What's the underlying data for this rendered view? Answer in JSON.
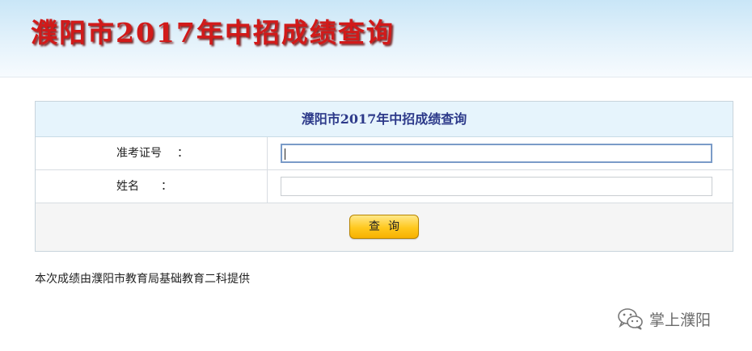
{
  "banner": {
    "title": "濮阳市2017年中招成绩查询"
  },
  "form": {
    "header": "濮阳市2017年中招成绩查询",
    "fields": [
      {
        "label": "准考证号",
        "colon": "：",
        "value": "",
        "focused": true
      },
      {
        "label": "姓名",
        "colon": "：",
        "value": ""
      }
    ],
    "submit_label": "查询"
  },
  "footer": {
    "note": "本次成绩由濮阳市教育局基础教育二科提供"
  },
  "watermark": {
    "text": "掌上濮阳",
    "icon": "wechat-icon"
  },
  "colors": {
    "title_red": "#d11a1a",
    "header_blue": "#2d3a8a",
    "button_gold": "#ffc81e"
  }
}
